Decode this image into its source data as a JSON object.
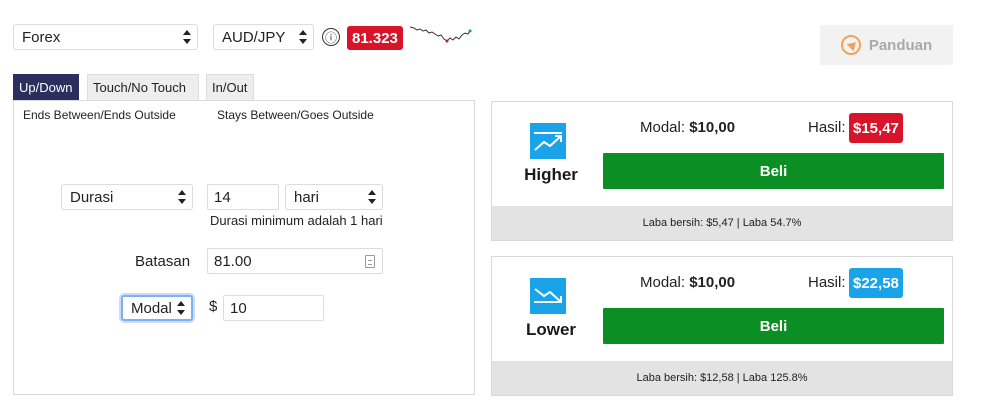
{
  "header": {
    "market_select": "Forex",
    "pair_select": "AUD/JPY",
    "info_glyph": "ⓘ",
    "price": "81.323",
    "guide_button": "Panduan"
  },
  "tabs": [
    {
      "label": "Up/Down",
      "active": true
    },
    {
      "label": "Touch/No Touch",
      "active": false
    },
    {
      "label": "In/Out",
      "active": false
    }
  ],
  "subtabs": [
    "Ends Between/Ends Outside",
    "Stays Between/Goes Outside"
  ],
  "form": {
    "duration_type": "Durasi",
    "duration_value": "14",
    "duration_unit": "hari",
    "duration_hint": "Durasi minimum adalah 1 hari",
    "barrier_label": "Batasan",
    "barrier_value": "81.00",
    "amount_type": "Modal",
    "currency_symbol": "$",
    "amount_value": "10"
  },
  "contracts": [
    {
      "name": "Higher",
      "icon": "trend-up-icon",
      "modal_label": "Modal:",
      "modal_value": "$10,00",
      "hasil_label": "Hasil:",
      "hasil_value": "$15,47",
      "hasil_color": "#d7142a",
      "buy_label": "Beli",
      "footer": "Laba bersih: $5,47 | Laba 54.7%"
    },
    {
      "name": "Lower",
      "icon": "trend-down-icon",
      "modal_label": "Modal:",
      "modal_value": "$10,00",
      "hasil_label": "Hasil:",
      "hasil_value": "$22,58",
      "hasil_color": "#1aa3e8",
      "buy_label": "Beli",
      "footer": "Laba bersih: $12,58 | Laba 125.8%"
    }
  ],
  "colors": {
    "active_tab": "#2a2f5d",
    "price_badge": "#d7142a",
    "buy_button": "#0b8f24",
    "icon_blue": "#1aa3e8"
  }
}
